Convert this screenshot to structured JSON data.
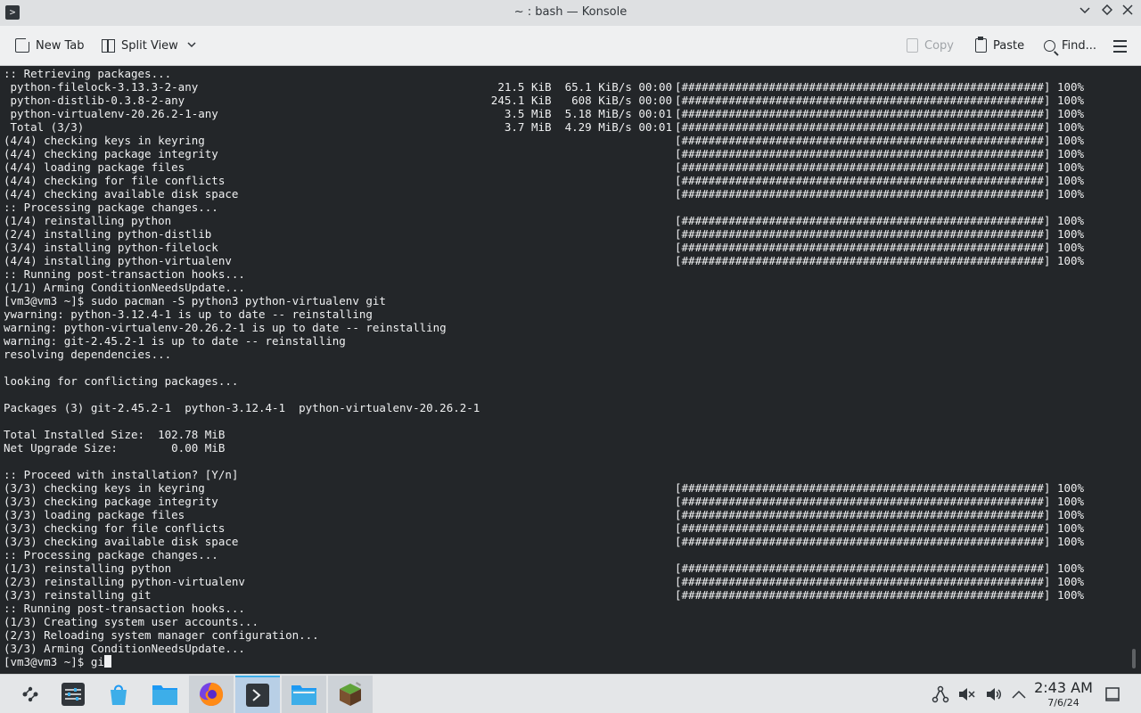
{
  "window": {
    "title": "~ : bash — Konsole",
    "app_icon": "terminal-icon",
    "controls": [
      "chevron-down-icon",
      "keep-above-icon",
      "close-icon"
    ]
  },
  "toolbar": {
    "new_tab": "New Tab",
    "split_view": "Split View",
    "copy": "Copy",
    "paste": "Paste",
    "find": "Find...",
    "menu_icon": "hamburger-menu-icon"
  },
  "terminal": {
    "lines": [
      {
        "text": ":: Retrieving packages..."
      },
      {
        "text": " python-filelock-3.13.3-2-any",
        "stats": "21.5 KiB  65.1 KiB/s 00:00",
        "bar": "[######################################################] 100%"
      },
      {
        "text": " python-distlib-0.3.8-2-any",
        "stats": "245.1 KiB   608 KiB/s 00:00",
        "bar": "[######################################################] 100%"
      },
      {
        "text": " python-virtualenv-20.26.2-1-any",
        "stats": "3.5 MiB  5.18 MiB/s 00:01",
        "bar": "[######################################################] 100%"
      },
      {
        "text": " Total (3/3)",
        "stats": "3.7 MiB  4.29 MiB/s 00:01",
        "bar": "[######################################################] 100%"
      },
      {
        "text": "(4/4) checking keys in keyring",
        "bar": "[######################################################] 100%"
      },
      {
        "text": "(4/4) checking package integrity",
        "bar": "[######################################################] 100%"
      },
      {
        "text": "(4/4) loading package files",
        "bar": "[######################################################] 100%"
      },
      {
        "text": "(4/4) checking for file conflicts",
        "bar": "[######################################################] 100%"
      },
      {
        "text": "(4/4) checking available disk space",
        "bar": "[######################################################] 100%"
      },
      {
        "text": ":: Processing package changes..."
      },
      {
        "text": "(1/4) reinstalling python",
        "bar": "[######################################################] 100%"
      },
      {
        "text": "(2/4) installing python-distlib",
        "bar": "[######################################################] 100%"
      },
      {
        "text": "(3/4) installing python-filelock",
        "bar": "[######################################################] 100%"
      },
      {
        "text": "(4/4) installing python-virtualenv",
        "bar": "[######################################################] 100%"
      },
      {
        "text": ":: Running post-transaction hooks..."
      },
      {
        "text": "(1/1) Arming ConditionNeedsUpdate..."
      },
      {
        "text": "[vm3@vm3 ~]$ sudo pacman -S python3 python-virtualenv git"
      },
      {
        "text": "ywarning: python-3.12.4-1 is up to date -- reinstalling"
      },
      {
        "text": "warning: python-virtualenv-20.26.2-1 is up to date -- reinstalling"
      },
      {
        "text": "warning: git-2.45.2-1 is up to date -- reinstalling"
      },
      {
        "text": "resolving dependencies..."
      },
      {
        "text": ""
      },
      {
        "text": "looking for conflicting packages..."
      },
      {
        "text": ""
      },
      {
        "text": "Packages (3) git-2.45.2-1  python-3.12.4-1  python-virtualenv-20.26.2-1"
      },
      {
        "text": ""
      },
      {
        "text": "Total Installed Size:  102.78 MiB"
      },
      {
        "text": "Net Upgrade Size:        0.00 MiB"
      },
      {
        "text": ""
      },
      {
        "text": ":: Proceed with installation? [Y/n]"
      },
      {
        "text": "(3/3) checking keys in keyring",
        "bar": "[######################################################] 100%"
      },
      {
        "text": "(3/3) checking package integrity",
        "bar": "[######################################################] 100%"
      },
      {
        "text": "(3/3) loading package files",
        "bar": "[######################################################] 100%"
      },
      {
        "text": "(3/3) checking for file conflicts",
        "bar": "[######################################################] 100%"
      },
      {
        "text": "(3/3) checking available disk space",
        "bar": "[######################################################] 100%"
      },
      {
        "text": ":: Processing package changes..."
      },
      {
        "text": "(1/3) reinstalling python",
        "bar": "[######################################################] 100%"
      },
      {
        "text": "(2/3) reinstalling python-virtualenv",
        "bar": "[######################################################] 100%"
      },
      {
        "text": "(3/3) reinstalling git",
        "bar": "[######################################################] 100%"
      },
      {
        "text": ":: Running post-transaction hooks..."
      },
      {
        "text": "(1/3) Creating system user accounts..."
      },
      {
        "text": "(2/3) Reloading system manager configuration..."
      },
      {
        "text": "(3/3) Arming ConditionNeedsUpdate..."
      }
    ],
    "prompt": "[vm3@vm3 ~]$ gi"
  },
  "taskbar": {
    "apps": [
      {
        "name": "application-launcher-icon"
      },
      {
        "name": "system-settings-icon"
      },
      {
        "name": "discover-store-icon"
      },
      {
        "name": "file-manager-icon"
      },
      {
        "name": "firefox-icon"
      },
      {
        "name": "konsole-icon"
      },
      {
        "name": "dolphin-window-icon"
      },
      {
        "name": "minecraft-icon"
      }
    ],
    "tray": [
      "network-icon",
      "audio-muted-icon",
      "volume-icon",
      "show-hidden-icon"
    ],
    "clock": {
      "time": "2:43 AM",
      "date": "7/6/24"
    },
    "show_desktop": "show-desktop-icon"
  },
  "colors": {
    "terminal_bg": "#232629",
    "terminal_fg": "#eff0f1",
    "accent": "#3daee9"
  }
}
